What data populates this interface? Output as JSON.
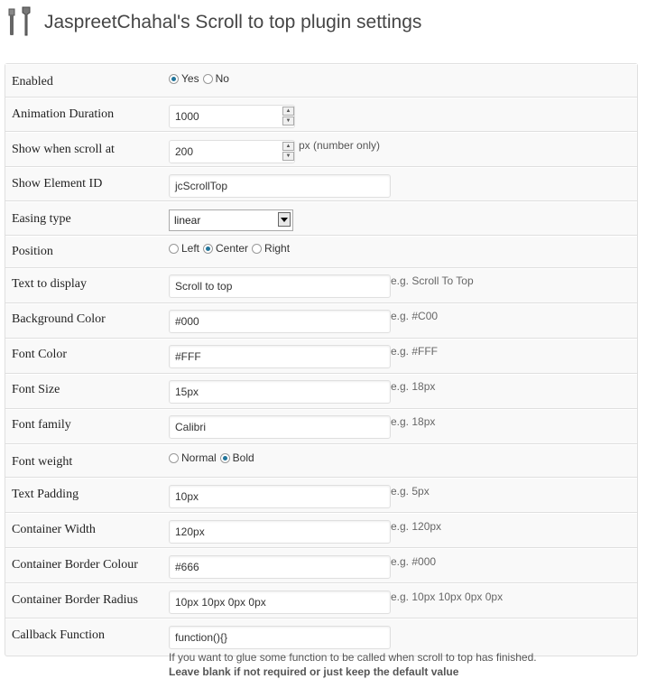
{
  "page": {
    "title": "JaspreetChahal's Scroll to top plugin settings",
    "icon": "tools-icon"
  },
  "settings": {
    "enabled": {
      "label": "Enabled",
      "options": [
        "Yes",
        "No"
      ],
      "selected": "Yes"
    },
    "animation_duration": {
      "label": "Animation Duration",
      "value": "1000"
    },
    "show_when_scroll": {
      "label": "Show when scroll at",
      "value": "200",
      "hint": "px (number only)"
    },
    "element_id": {
      "label": "Show Element ID",
      "value": "jcScrollTop"
    },
    "easing": {
      "label": "Easing type",
      "value": "linear"
    },
    "position": {
      "label": "Position",
      "options": [
        "Left",
        "Center",
        "Right"
      ],
      "selected": "Center"
    },
    "text_display": {
      "label": "Text to display",
      "value": "Scroll to top",
      "hint": "e.g. Scroll To Top"
    },
    "bg_color": {
      "label": "Background Color",
      "value": "#000",
      "hint": "e.g. #C00"
    },
    "font_color": {
      "label": "Font Color",
      "value": "#FFF",
      "hint": "e.g. #FFF"
    },
    "font_size": {
      "label": "Font Size",
      "value": "15px",
      "hint": "e.g. 18px"
    },
    "font_family": {
      "label": "Font family",
      "value": "Calibri",
      "hint": "e.g. 18px"
    },
    "font_weight": {
      "label": "Font weight",
      "options": [
        "Normal",
        "Bold"
      ],
      "selected": "Bold"
    },
    "text_padding": {
      "label": "Text Padding",
      "value": "10px",
      "hint": "e.g. 5px"
    },
    "container_width": {
      "label": "Container Width",
      "value": "120px",
      "hint": "e.g. 120px"
    },
    "border_colour": {
      "label": "Container Border Colour",
      "value": "#666",
      "hint": "e.g. #000"
    },
    "border_radius": {
      "label": "Container Border Radius",
      "value": "10px 10px 0px 0px",
      "hint": "e.g. 10px 10px 0px 0px"
    },
    "callback": {
      "label": "Callback Function",
      "value": "function(){}",
      "help": "If you want to glue some function to be called when scroll to top has finished.",
      "help_bold": "Leave blank if not required or just keep the default value"
    }
  },
  "colors": {
    "accent": "#21759b",
    "border": "#dfdfdf",
    "background": "#f9f9f9"
  }
}
